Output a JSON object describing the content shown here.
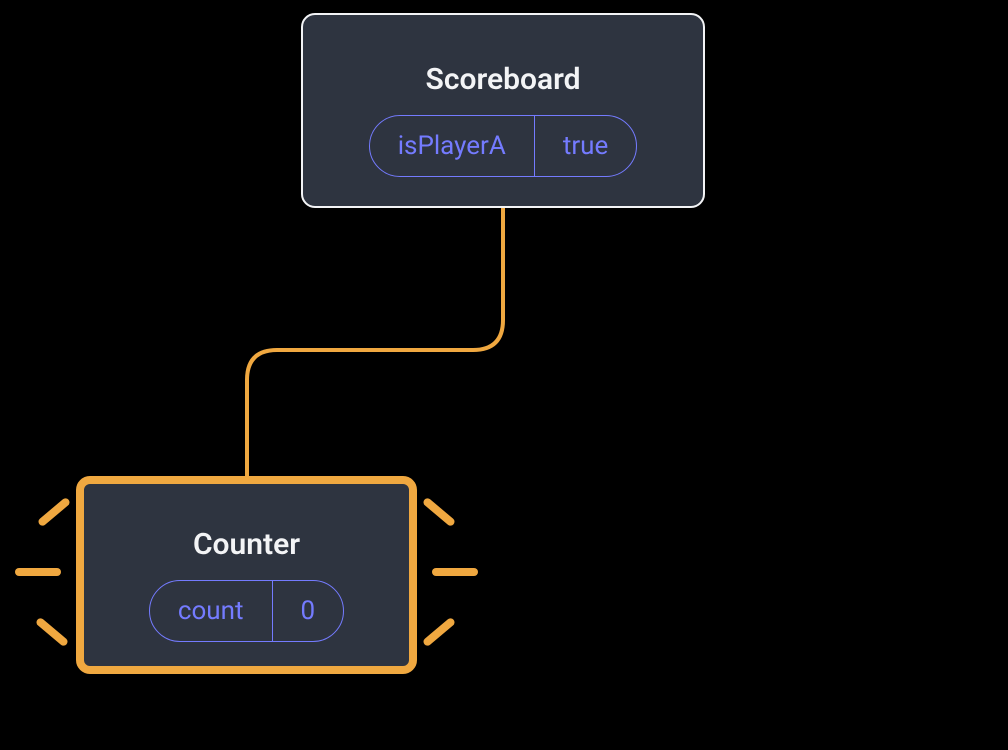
{
  "parent": {
    "title": "Scoreboard",
    "state": {
      "key": "isPlayerA",
      "value": "true"
    }
  },
  "child": {
    "title": "Counter",
    "state": {
      "key": "count",
      "value": "0"
    }
  },
  "colors": {
    "node_bg": "#2E3440",
    "node_border": "#F3F4F6",
    "highlight": "#F0A840",
    "state_accent": "#747BFF"
  }
}
